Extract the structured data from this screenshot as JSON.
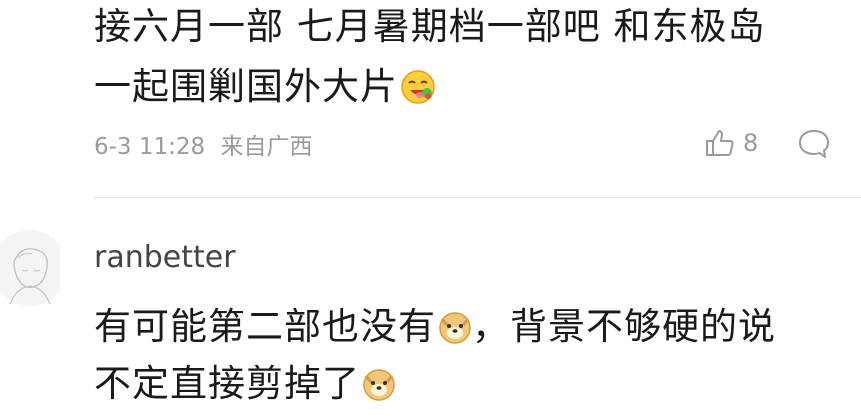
{
  "previous_comment": {
    "line1": "接六月一部 七月暑期档一部吧 和东极岛",
    "line2": "一起围剿国外大片",
    "emoji": "yum-emoji",
    "timestamp": "6-3 11:28",
    "location": "来自广西",
    "like_count": "8"
  },
  "comment": {
    "username": "ranbetter",
    "line1_a": "有可能第二部也没有",
    "line1_b": "，背景不够硬的说",
    "line2": "不定直接剪掉了",
    "emoji": "doge-emoji"
  },
  "icons": {
    "like": "thumbs-up-icon",
    "reply": "comment-bubble-icon"
  }
}
